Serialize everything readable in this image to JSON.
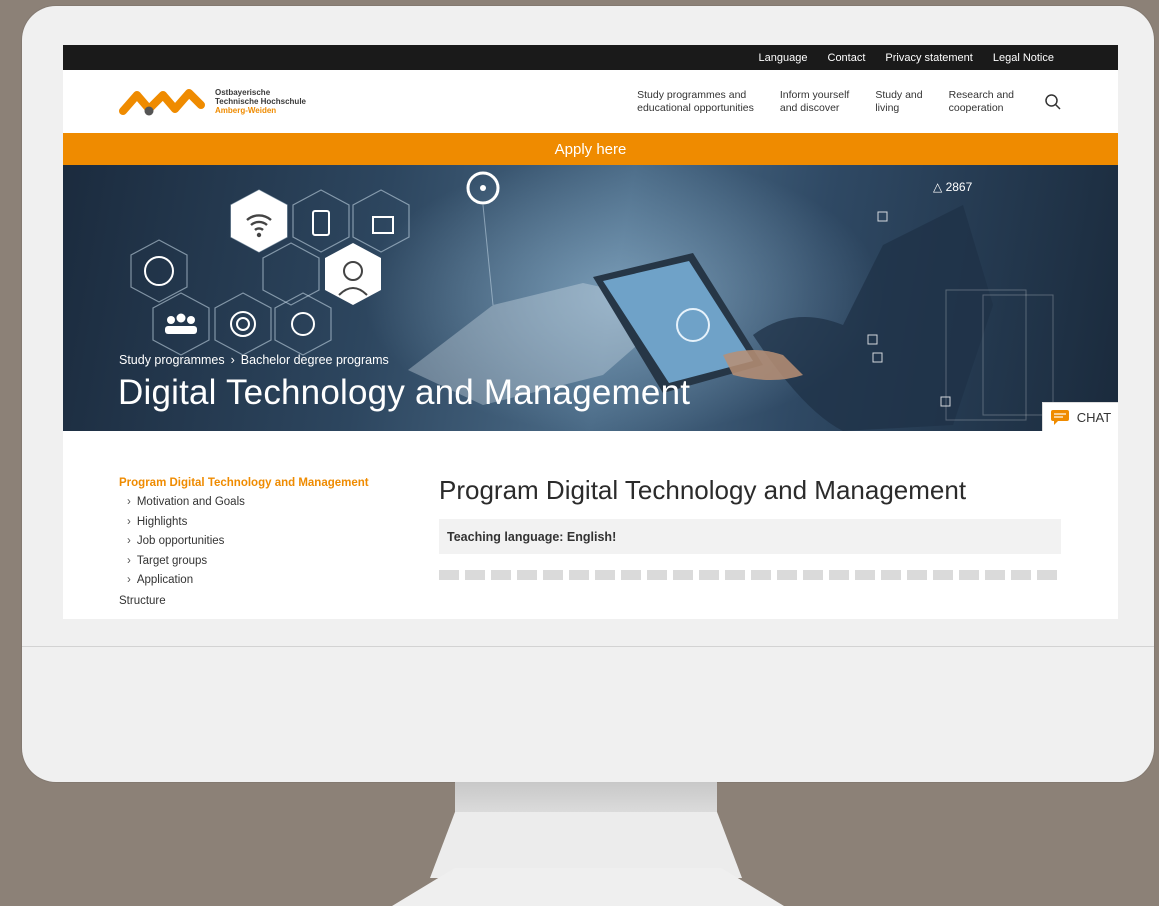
{
  "topbar": {
    "links": [
      "Language",
      "Contact",
      "Privacy statement",
      "Legal Notice"
    ]
  },
  "logo": {
    "line1": "Ostbayerische",
    "line2": "Technische Hochschule",
    "line3": "Amberg-Weiden"
  },
  "nav": {
    "items": [
      {
        "line1": "Study programmes and",
        "line2": "educational opportunities"
      },
      {
        "line1": "Inform yourself",
        "line2": "and discover"
      },
      {
        "line1": "Study and",
        "line2": "living"
      },
      {
        "line1": "Research and",
        "line2": "cooperation"
      }
    ],
    "search_icon": "search-icon"
  },
  "apply": {
    "label": "Apply here"
  },
  "hero": {
    "breadcrumb": [
      "Study programmes",
      "›",
      "Bachelor degree programs"
    ],
    "title": "Digital Technology and Management",
    "hud_label": "△ 2867",
    "chat_label": "CHAT"
  },
  "sidenav": {
    "active": "Program Digital Technology and Management",
    "items": [
      "Motivation and Goals",
      "Highlights",
      "Job opportunities",
      "Target groups",
      "Application"
    ],
    "section": "Structure"
  },
  "main": {
    "heading": "Program Digital Technology and Management",
    "note": "Teaching language: English!"
  },
  "colors": {
    "accent": "#ef8b00",
    "topbar": "#1a1a1a",
    "background": "#8c8177"
  }
}
